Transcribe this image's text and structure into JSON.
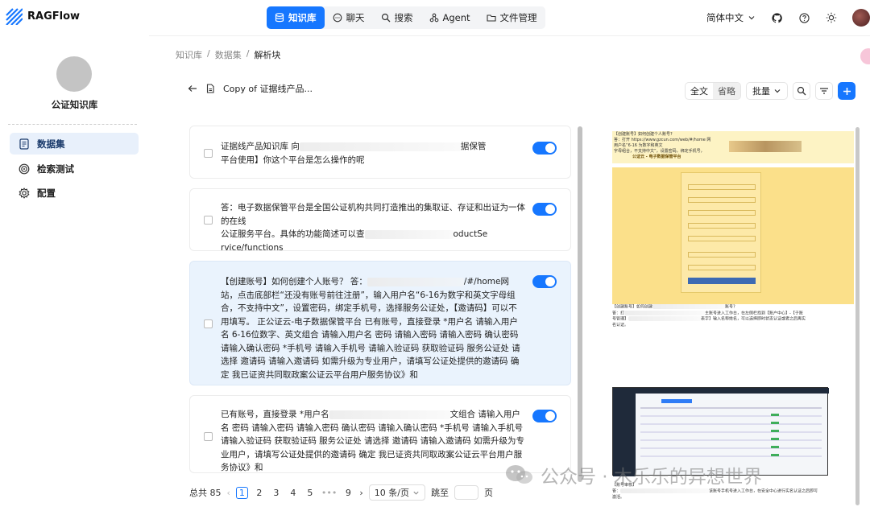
{
  "app": {
    "name": "RAGFlow"
  },
  "nav": {
    "items": [
      {
        "label": "知识库",
        "icon": "database-icon",
        "active": true
      },
      {
        "label": "聊天",
        "icon": "chat-icon",
        "active": false
      },
      {
        "label": "搜索",
        "icon": "search-icon",
        "active": false
      },
      {
        "label": "Agent",
        "icon": "agent-icon",
        "active": false
      },
      {
        "label": "文件管理",
        "icon": "folder-icon",
        "active": false
      }
    ]
  },
  "header_right": {
    "language": "简体中文"
  },
  "sidebar": {
    "kb_name": "公证知识库",
    "items": [
      {
        "label": "数据集",
        "icon": "file-icon",
        "active": true
      },
      {
        "label": "检索测试",
        "icon": "target-icon",
        "active": false
      },
      {
        "label": "配置",
        "icon": "gear-icon",
        "active": false
      }
    ]
  },
  "breadcrumb": {
    "items": [
      "知识库",
      "数据集",
      "解析块"
    ]
  },
  "document": {
    "title": "Copy of 证据线产品..."
  },
  "toolbar": {
    "full_text": "全文",
    "omit": "省略",
    "bulk": "批量"
  },
  "chunks": [
    {
      "text_a": "证据线产品知识库 向",
      "text_b": "据保管",
      "text_c": "平台使用】你这个平台是怎么操作的呢",
      "enabled": true
    },
    {
      "text_a": "答：电子数据保管平台是全国公证机构共同打造推出的集取证、存证和出证为一体的在线",
      "text_b": "公证服务平台。具体的功能简述可以查",
      "text_c": "oductSe",
      "text_d": "rvice/functions",
      "enabled": true
    },
    {
      "text_a": "【创建账号】如何创建个人账号？ 答：",
      "text_b": "/#/home网",
      "text_c": "站，点击底部栏“还没有账号前往注册”，输入用户名“6-16为数字和英文字母组合，不支持中文”，设置密码，绑定手机号，选择服务公证处，【邀请码】可以不用填写。 正公证云-电子数据保管平台 已有账号，直接登录 *用户名 请输入用户名 6-16位数字、英文组合 请输入用户名 密码 请输入密码 请输入密码 确认密码 请输入确认密码 *手机号 请输入手机号 请输入验证码 获取验证码 服务公证处 请选择 邀请码 请输入邀请码 如需升级为专业用户，请填写公证处提供的邀请码 确定 我已证资共同取政案公证云平台用户服务协议》和",
      "enabled": true,
      "selected": true
    },
    {
      "text_a": "已有账号，直接登录 *用户名",
      "text_b": "文组合 请输入用户名 密码",
      "text_c": "请输入密码 请输入密码 确认密码 请输入确认密码 *手机号 请输入手机号 请输入验证码 获取验证码 服务公证处 请选择 邀请码 请输入邀请码 如需升级为专业用户，请填写公证处提供的邀请码 确定 我已证资共同取政案公证云平台用户服务协议》和",
      "enabled": true
    }
  ],
  "pagination": {
    "total": "总共 85",
    "pages": [
      "1",
      "2",
      "3",
      "4",
      "5",
      "•••",
      "9"
    ],
    "current": "1",
    "page_size": "10 条/页",
    "jump_label": "跳至",
    "page_suffix": "页"
  },
  "preview": {
    "lines_top": [
      "【创建账号】如何创建个人账号?",
      "答：打开 https://www.gzcun.com/web/#/home 网",
      "用户名“6-16 为数字和英文",
      "字母组合，不支持中文”，设置密码，绑定手机号，",
      "公证云 - 电子数据保管平台"
    ],
    "lines_mid": [
      "【创建账号】如何创建",
      "账号?",
      "答：打",
      "主账号进入工作台，在左侧栏找到【账户中心】-【子账",
      "号管理】",
      "表字】输入名称姓名，可以选择即时状态认证或者之后再实",
      "名认证。"
    ],
    "lines_bottom": [
      "【账号审核】",
      "答：",
      "该账号手机号进入工作台，在安全中心进行实名认证之后即可",
      "激活。"
    ],
    "colors": {
      "yellow": "#fbe08a",
      "dark": "#1f2a3a"
    }
  },
  "watermark": {
    "text": "公众号 · 木乐乐的异想世界"
  }
}
